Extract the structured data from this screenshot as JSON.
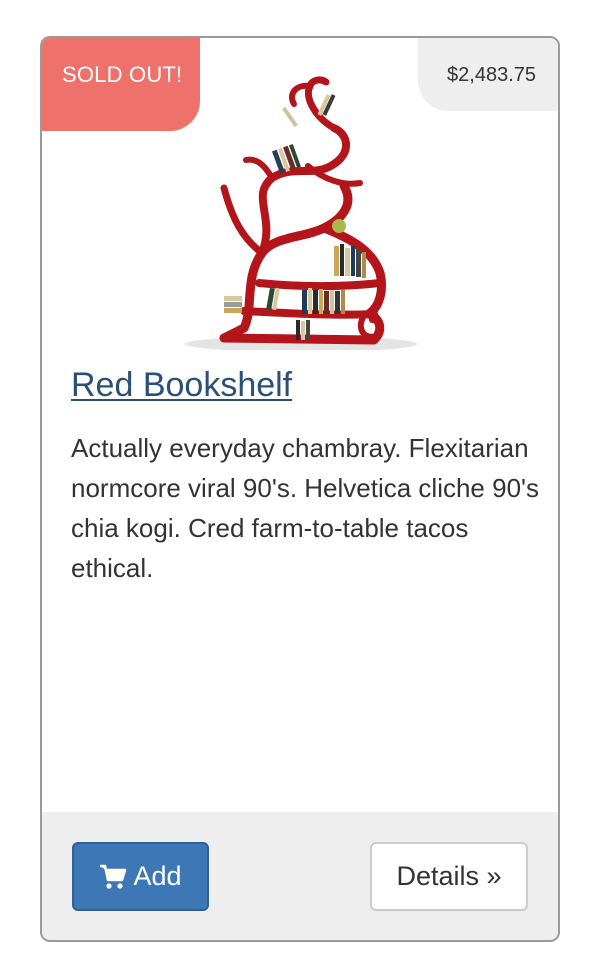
{
  "product": {
    "sold_badge": "SOLD OUT!",
    "price": "$2,483.75",
    "image_name": "red-bookshelf-image",
    "title": "Red Bookshelf",
    "description": "Actually everyday chambray. Flexitarian normcore viral 90's. Helvetica cliche 90's chia kogi. Cred farm-to-table tacos ethical."
  },
  "actions": {
    "add_label": "Add",
    "add_icon": "cart-icon",
    "details_label": "Details »"
  },
  "colors": {
    "sold_badge_bg": "#ef716b",
    "price_badge_bg": "#eeeeee",
    "title_link": "#2a5078",
    "primary_button": "#3e77b5",
    "shelf_red": "#b3151b"
  }
}
